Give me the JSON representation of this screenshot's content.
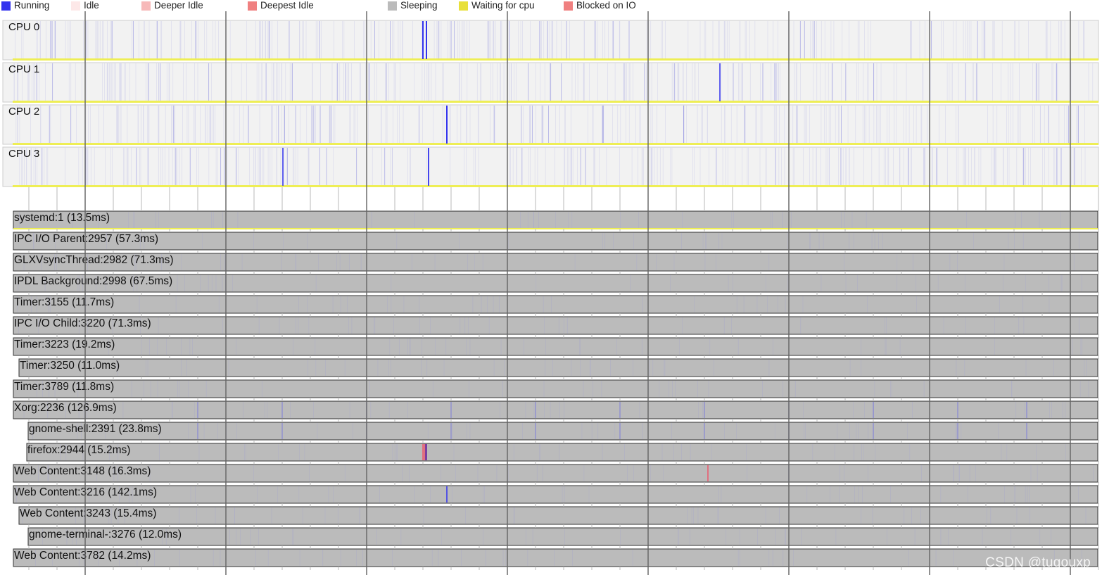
{
  "legend": [
    {
      "label": "Running",
      "color": "#3333ee"
    },
    {
      "label": "Idle",
      "color": "#fde8e8"
    },
    {
      "label": "Deeper Idle",
      "color": "#f7b9b9"
    },
    {
      "label": "Deepest Idle",
      "color": "#f08080"
    },
    {
      "label": "Sleeping",
      "color": "#bbbbbb"
    },
    {
      "label": "Waiting for cpu",
      "color": "#e8e03a"
    },
    {
      "label": "Blocked on IO",
      "color": "#f08080"
    }
  ],
  "colors": {
    "cpu_lane_bg": "#f2f2f2",
    "cpu_lane_border": "#cccccc",
    "cpu_baseline": "#eeee55",
    "thread_bar": "#bbbbbb",
    "thread_border": "#333333",
    "running_mark": "#3333ee",
    "faint_mark": "#b9b9e4",
    "blocked_mark": "#e07080",
    "major_gridline": "#666666",
    "minor_gridline": "#b8b8b8",
    "text": "#111111"
  },
  "cpus": [
    {
      "name": "CPU 0"
    },
    {
      "name": "CPU 1"
    },
    {
      "name": "CPU 2"
    },
    {
      "name": "CPU 3"
    }
  ],
  "threads": [
    {
      "label": "systemd:1 (13.5ms)"
    },
    {
      "label": "IPC I/O Parent:2957 (57.3ms)"
    },
    {
      "label": "GLXVsyncThread:2982 (71.3ms)"
    },
    {
      "label": "IPDL Background:2998 (67.5ms)"
    },
    {
      "label": "Timer:3155 (11.7ms)"
    },
    {
      "label": "IPC I/O Child:3220 (71.3ms)"
    },
    {
      "label": "Timer:3223 (19.2ms)"
    },
    {
      "label": "Timer:3250 (11.0ms)"
    },
    {
      "label": "Timer:3789 (11.8ms)"
    },
    {
      "label": "Xorg:2236 (126.9ms)"
    },
    {
      "label": "gnome-shell:2391 (23.8ms)"
    },
    {
      "label": "firefox:2944 (15.2ms)"
    },
    {
      "label": "Web Content:3148 (16.3ms)"
    },
    {
      "label": "Web Content:3216 (142.1ms)"
    },
    {
      "label": "Web Content:3243 (15.4ms)"
    },
    {
      "label": "gnome-terminal-:3276 (12.0ms)"
    },
    {
      "label": "Web Content:3782 (14.2ms)"
    }
  ],
  "watermark": "CSDN @tugouxp"
}
